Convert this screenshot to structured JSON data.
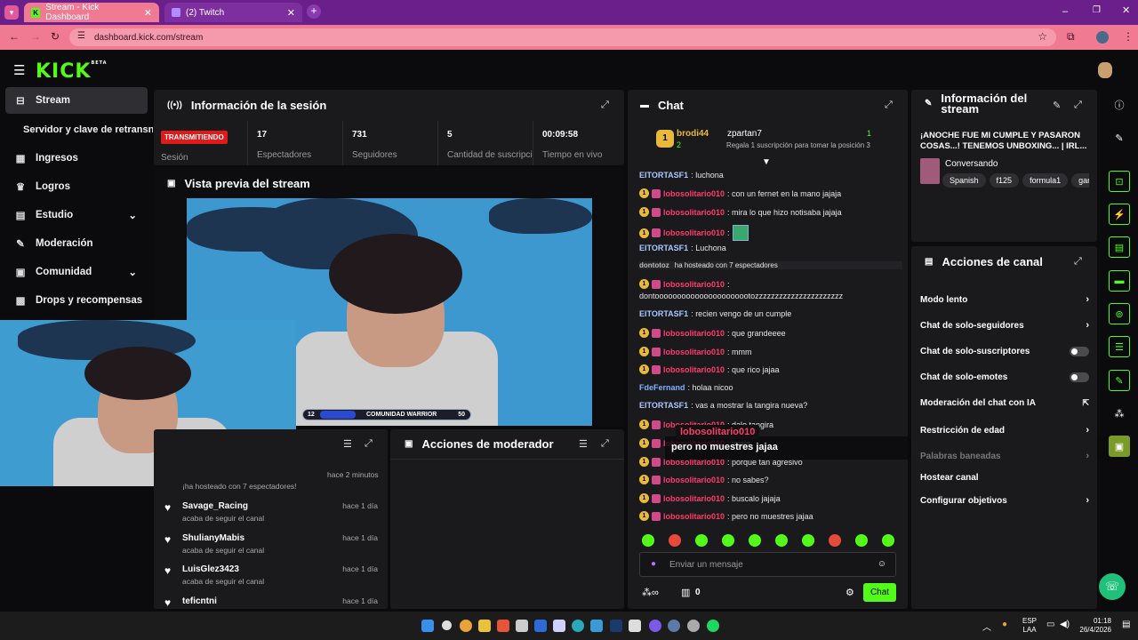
{
  "browser": {
    "tabs": [
      {
        "label": "Stream - Kick Dashboard"
      },
      {
        "label": "(2) Twitch"
      }
    ],
    "url": "dashboard.kick.com/stream"
  },
  "kick": {
    "logo": "KICK",
    "logo_sup": "BETA"
  },
  "sidebar": {
    "items": [
      {
        "label": "Stream",
        "icon": "broadcast-icon"
      },
      {
        "label": "Servidor y clave de retransn",
        "icon": ""
      },
      {
        "label": "Ingresos",
        "icon": "money-icon"
      },
      {
        "label": "Logros",
        "icon": "trophy-icon"
      },
      {
        "label": "Estudio",
        "icon": "studio-icon"
      },
      {
        "label": "Moderación",
        "icon": "wrench-icon"
      },
      {
        "label": "Comunidad",
        "icon": "community-icon"
      },
      {
        "label": "Drops y recompensas",
        "icon": "gift-icon"
      }
    ]
  },
  "session": {
    "title": "Información de la sesión",
    "badge": "TRANSMITIENDO",
    "badge_label": "Sesión",
    "stats": [
      {
        "value": "17",
        "label": "Espectadores"
      },
      {
        "value": "731",
        "label": "Seguidores"
      },
      {
        "value": "5",
        "label": "Cantidad de suscripciones"
      },
      {
        "value": "00:09:58",
        "label": "Tiempo en vivo"
      }
    ]
  },
  "preview": {
    "title": "Vista previa del stream",
    "goal_left": "12",
    "goal_label": "COMUNIDAD WARRIOR",
    "goal_right": "50",
    "goal_progress": 0.24
  },
  "activity": {
    "first_time": "hace 2 minutos",
    "first_text": "¡ha hosteado con 7 espectadores!",
    "items": [
      {
        "name": "Savage_Racing",
        "sub": "acaba de seguir el canal",
        "time": "hace 1 día"
      },
      {
        "name": "ShulianyMabis",
        "sub": "acaba de seguir el canal",
        "time": "hace 1 día"
      },
      {
        "name": "LuisGlez3423",
        "sub": "acaba de seguir el canal",
        "time": "hace 1 día"
      },
      {
        "name": "teficntni",
        "sub": "",
        "time": "hace 1 día"
      }
    ]
  },
  "moderator": {
    "title": "Acciones de moderador"
  },
  "chat": {
    "title": "Chat",
    "top_gifter": {
      "rank": "1",
      "name": "brodi44",
      "count": "2"
    },
    "second": {
      "name": "zpartan7",
      "count": "1",
      "note": "Regala 1 suscripción para tomar la posición 3"
    },
    "messages": [
      {
        "user": "EITORTASF1",
        "text": ": luchona",
        "color": "#a9c8ff",
        "badges": false
      },
      {
        "user": "lobosolitario010",
        "text": ": con un fernet en la mano jajaja",
        "color": "#ff3b6a",
        "badges": true
      },
      {
        "user": "lobosolitario010",
        "text": ": mira lo que hizo notisaba jajaja",
        "color": "#ff3b6a",
        "badges": true
      },
      {
        "user": "lobosolitario010",
        "text": ":",
        "color": "#ff3b6a",
        "badges": true
      },
      {
        "user": "EITORTASF1",
        "text": ": Luchona",
        "color": "#a9c8ff",
        "badges": false
      },
      {
        "user": "dontotoz",
        "text": "ha hosteado con 7 espectadores",
        "color": "#bbbbbb",
        "badges": false
      },
      {
        "user": "lobosolitario010",
        "text": ":",
        "color": "#ff3b6a",
        "badges": true
      },
      {
        "user": "",
        "text": "dontoooooooooooooooooooootozzzzzzzzzzzzzzzzzzzzzz",
        "color": "#ffffff",
        "badges": false
      },
      {
        "user": "EITORTASF1",
        "text": ": recien vengo de un cumple",
        "color": "#a9c8ff",
        "badges": false
      },
      {
        "user": "lobosolitario010",
        "text": ": que grandeeee",
        "color": "#ff3b6a",
        "badges": true
      },
      {
        "user": "lobosolitario010",
        "text": ": mmm",
        "color": "#ff3b6a",
        "badges": true
      },
      {
        "user": "lobosolitario010",
        "text": ": que rico jajaa",
        "color": "#ff3b6a",
        "badges": true
      },
      {
        "user": "FdeFernand",
        "text": ": holaa nicoo",
        "color": "#7fb0ff",
        "badges": false
      },
      {
        "user": "EITORTASF1",
        "text": ": vas a mostrar la tangira nueva?",
        "color": "#a9c8ff",
        "badges": false
      },
      {
        "user": "lobosolitario010",
        "text": ": dale tangira",
        "color": "#ff3b6a",
        "badges": true
      },
      {
        "user": "lobosolitario010",
        "text": ": jajaja",
        "color": "#ff3b6a",
        "badges": true
      },
      {
        "user": "lobosolitario010",
        "text": ": porque tan agresivo",
        "color": "#ff3b6a",
        "badges": true
      },
      {
        "user": "lobosolitario010",
        "text": ": no sabes?",
        "color": "#ff3b6a",
        "badges": true
      },
      {
        "user": "lobosolitario010",
        "text": ": buscalo jajaja",
        "color": "#ff3b6a",
        "badges": true
      },
      {
        "user": "lobosolitario010",
        "text": ": pero no muestres jajaa",
        "color": "#ff3b6a",
        "badges": true
      }
    ],
    "overlay_user": "lobosolitario010",
    "overlay_text": "pero no muestres jajaa",
    "input_placeholder": "Enviar un mensaje",
    "points": "0",
    "send_label": "Chat"
  },
  "stream_info": {
    "title": "Información del stream",
    "stream_title": "¡ANOCHE FUE MI CUMPLE Y PASARON COSAS...! TENEMOS UNBOXING... | IRL...",
    "category": "Conversando",
    "tags": [
      "Spanish",
      "f125",
      "formula1",
      "gam"
    ]
  },
  "channel_actions": {
    "title": "Acciones de canal",
    "items": [
      {
        "label": "Modo lento",
        "control": "arrow"
      },
      {
        "label": "Chat de solo-seguidores",
        "control": "arrow"
      },
      {
        "label": "Chat de solo-suscriptores",
        "control": "toggle"
      },
      {
        "label": "Chat de solo-emotes",
        "control": "toggle"
      },
      {
        "label": "Moderación del chat con IA",
        "control": "external"
      },
      {
        "label": "Restricción de edad",
        "control": "arrow"
      },
      {
        "label": "Palabras baneadas",
        "control": "arrow"
      },
      {
        "label": "Hostear canal",
        "control": "none"
      },
      {
        "label": "Configurar objetivos",
        "control": "arrow"
      }
    ]
  },
  "taskbar": {
    "lang": "ESP",
    "lang2": "LAA",
    "time": "01:18",
    "date": "26/4/2026"
  },
  "colors": {
    "accent": "#53fc18",
    "tabbar": "#6a1f8a",
    "addressbar": "#f07a92",
    "live": "#e01a1a"
  }
}
